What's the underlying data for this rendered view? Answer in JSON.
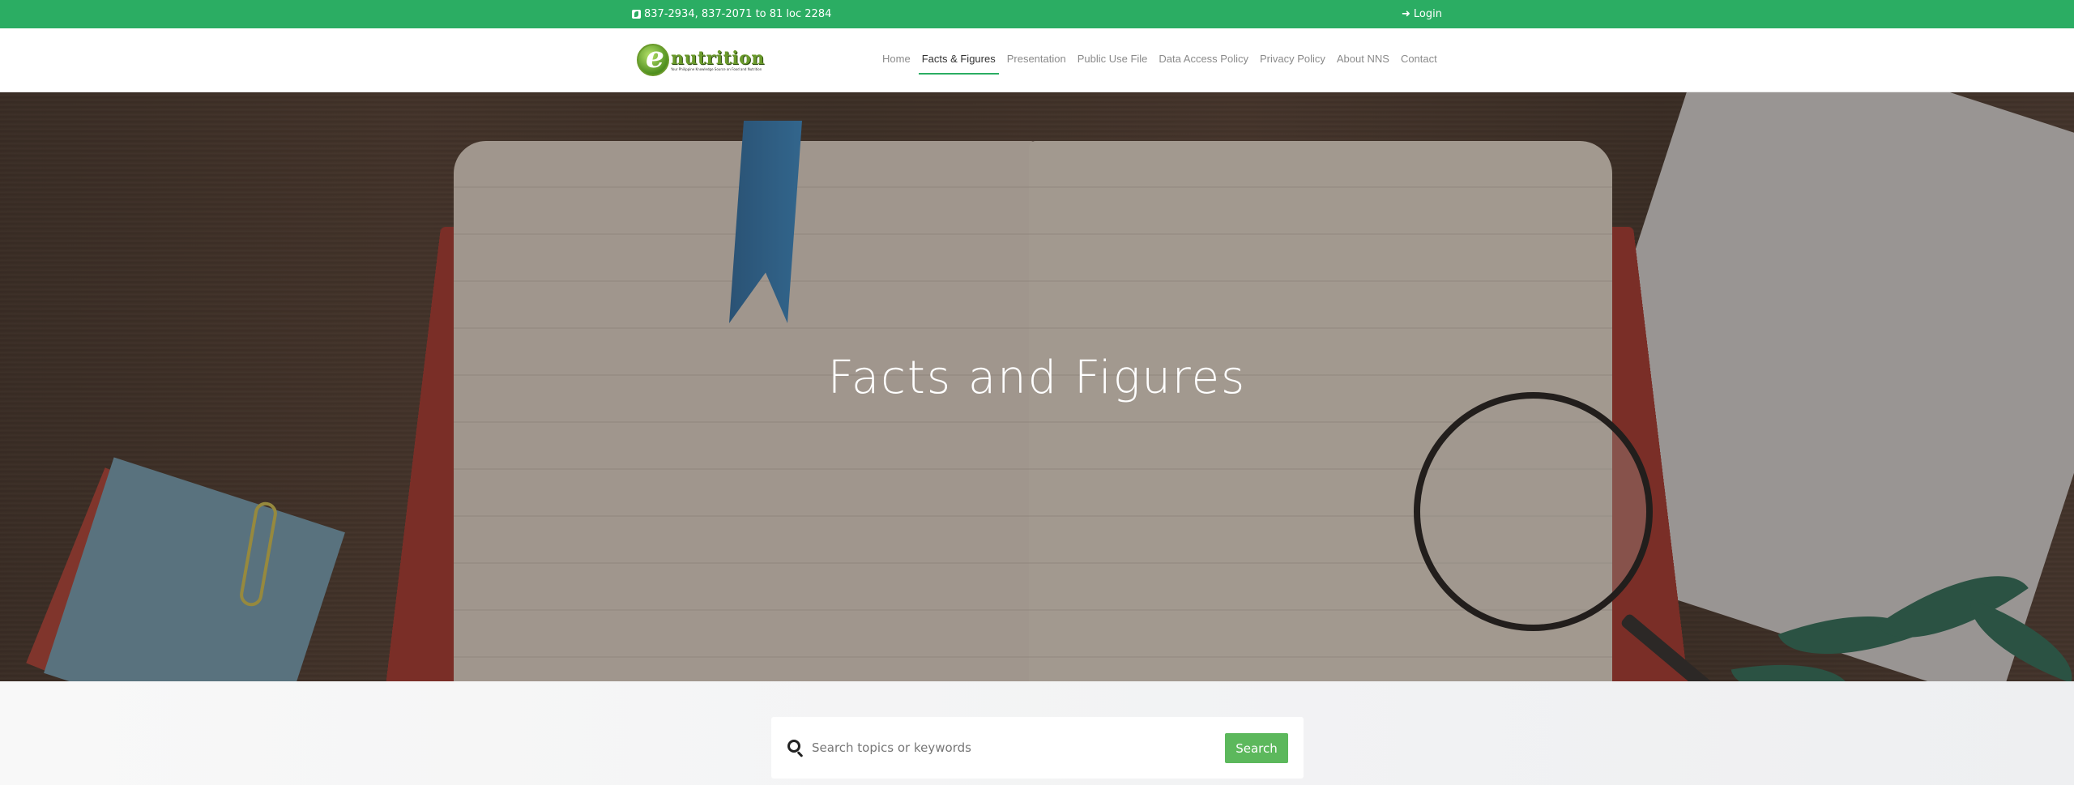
{
  "topbar": {
    "phone_icon": "phone-square-icon",
    "phone_text": "837-2934, 837-2071 to 81 loc 2284",
    "login_icon": "sign-in-icon",
    "login_label": "Login",
    "color": "#2bad63"
  },
  "logo": {
    "word": "nutrition",
    "tagline": "Your Philippine Knowledge Source on Food and Nutrition"
  },
  "nav": {
    "items": [
      {
        "label": "Home",
        "active": false
      },
      {
        "label": "Facts & Figures",
        "active": true
      },
      {
        "label": "Presentation",
        "active": false
      },
      {
        "label": "Public Use File",
        "active": false
      },
      {
        "label": "Data Access Policy",
        "active": false
      },
      {
        "label": "Privacy Policy",
        "active": false
      },
      {
        "label": "About NNS",
        "active": false
      },
      {
        "label": "Contact",
        "active": false
      }
    ],
    "active_color": "#2bad63"
  },
  "hero": {
    "title": "Facts and Figures"
  },
  "search": {
    "placeholder": "Search topics or keywords",
    "value": "",
    "button_label": "Search",
    "button_color": "#5cb85c"
  }
}
